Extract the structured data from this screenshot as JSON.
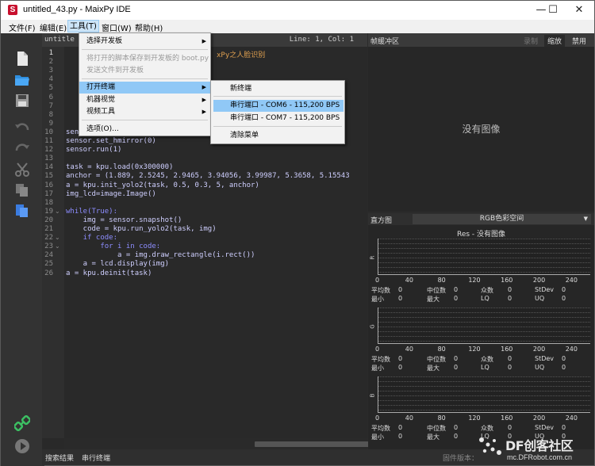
{
  "window": {
    "title": "untitled_43.py - MaixPy IDE",
    "minimize": "—",
    "maximize": "☐",
    "close": "✕"
  },
  "menubar": [
    "文件(F)",
    "编辑(E)",
    "工具(T)",
    "窗口(W)",
    "帮助(H)"
  ],
  "editor": {
    "file_name": "untitle",
    "line_col": "Line: 1, Col: 1",
    "partial_comment": "xPy之人脸识别",
    "code_lines": [
      {
        "n": "1",
        "t": ""
      },
      {
        "n": "2",
        "t": ""
      },
      {
        "n": "3",
        "t": ""
      },
      {
        "n": "4",
        "t": ""
      },
      {
        "n": "5",
        "t": ""
      },
      {
        "n": "6",
        "t": ""
      },
      {
        "n": "7",
        "t": ""
      },
      {
        "n": "8",
        "t": ""
      },
      {
        "n": "9",
        "t": ""
      },
      {
        "n": "10",
        "t": "sensor.set_framesize(sensor.QVGA)"
      },
      {
        "n": "11",
        "t": "sensor.set_hmirror(0)"
      },
      {
        "n": "12",
        "t": "sensor.run(1)"
      },
      {
        "n": "13",
        "t": ""
      },
      {
        "n": "14",
        "t": "task = kpu.load(0x300000)"
      },
      {
        "n": "15",
        "t": "anchor = (1.889, 2.5245, 2.9465, 3.94056, 3.99987, 5.3658, 5.15543"
      },
      {
        "n": "16",
        "t": "a = kpu.init_yolo2(task, 0.5, 0.3, 5, anchor)"
      },
      {
        "n": "17",
        "t": "img_lcd=image.Image()"
      },
      {
        "n": "18",
        "t": ""
      },
      {
        "n": "19",
        "t": "while(True):"
      },
      {
        "n": "20",
        "t": "    img = sensor.snapshot()"
      },
      {
        "n": "21",
        "t": "    code = kpu.run_yolo2(task, img)"
      },
      {
        "n": "22",
        "t": "    if code:"
      },
      {
        "n": "23",
        "t": "        for i in code:"
      },
      {
        "n": "24",
        "t": "            a = img.draw_rectangle(i.rect())"
      },
      {
        "n": "25",
        "t": "    a = lcd.display(img)"
      },
      {
        "n": "26",
        "t": "a = kpu.deinit(task)"
      }
    ]
  },
  "tools_menu": {
    "items": [
      {
        "label": "选择开发板",
        "submenu": true,
        "disabled": false
      },
      {
        "label": "将打开的脚本保存到开发板的 boot.py",
        "submenu": false,
        "disabled": true
      },
      {
        "label": "发送文件到开发板",
        "submenu": false,
        "disabled": true
      },
      {
        "label": "打开终端",
        "submenu": true,
        "disabled": false,
        "highlighted": true
      },
      {
        "label": "机器视觉",
        "submenu": true,
        "disabled": false
      },
      {
        "label": "视频工具",
        "submenu": true,
        "disabled": false
      },
      {
        "label": "选项(O)...",
        "submenu": false,
        "disabled": false
      }
    ]
  },
  "terminal_submenu": {
    "items": [
      {
        "label": "新终端"
      },
      {
        "label": "串行端口 - COM6 - 115,200 BPS",
        "highlighted": true
      },
      {
        "label": "串行端口 - COM7 - 115,200 BPS"
      },
      {
        "label": "清除菜单"
      }
    ]
  },
  "framebuffer": {
    "title": "帧缓冲区",
    "buttons": [
      "录制",
      "缩放",
      "禁用"
    ],
    "no_image": "没有图像"
  },
  "histogram": {
    "title": "直方图",
    "color_space": "RGB色彩空间",
    "resolution": "Res - 没有图像",
    "channels": [
      "R",
      "G",
      "B"
    ],
    "ticks": [
      "0",
      "40",
      "80",
      "120",
      "160",
      "200",
      "240"
    ],
    "stats": {
      "row1": [
        "平均数",
        "0",
        "中位数",
        "0",
        "众数",
        "0",
        "StDev",
        "0"
      ],
      "row2": [
        "最小",
        "0",
        "最大",
        "0",
        "LQ",
        "0",
        "UQ",
        "0"
      ]
    }
  },
  "statusbar": {
    "tabs": [
      "搜索结果",
      "串行终端"
    ],
    "firmware": "固件版本："
  },
  "watermark": {
    "name": "DF创客社区",
    "url": "mc.DFRobot.com.cn"
  },
  "colors": {
    "accent_highlight": "#90c8f6",
    "editor_bg": "#292929",
    "keyword": "#8d8dff",
    "comment": "#e0a050"
  }
}
